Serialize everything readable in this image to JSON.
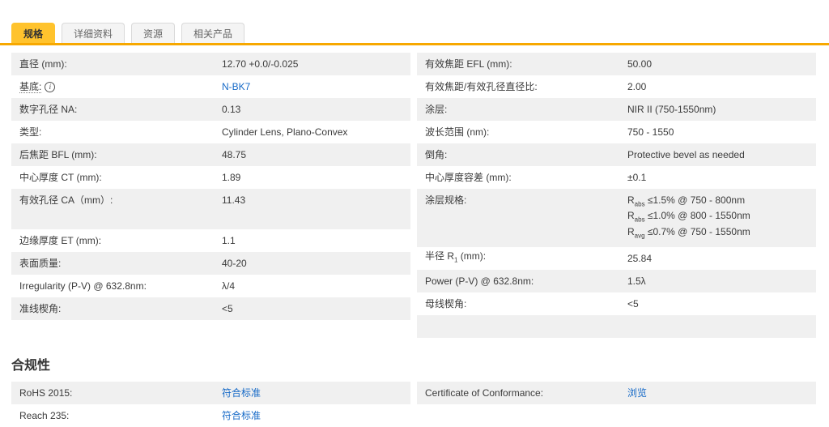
{
  "colors": {
    "accent_yellow": "#ffc32d",
    "tab_underline_orange": "#f7a800",
    "link_blue": "#1569c7",
    "row_gray": "#f0f0f0",
    "text": "#3b3b3b"
  },
  "tabs": [
    {
      "label": "规格",
      "active": true
    },
    {
      "label": "详细资料",
      "active": false
    },
    {
      "label": "资源",
      "active": false
    },
    {
      "label": "相关产品",
      "active": false
    }
  ],
  "icons": {
    "info_glyph": "i"
  },
  "spec_left": {
    "rows": [
      {
        "label": "直径 (mm):",
        "value": "12.70 +0.0/-0.025"
      },
      {
        "label": "基底:",
        "value": "N-BK7"
      },
      {
        "label": "数字孔径 NA:",
        "value": "0.13"
      },
      {
        "label": "类型:",
        "value": "Cylinder Lens, Plano-Convex"
      },
      {
        "label": "后焦距 BFL (mm):",
        "value": "48.75"
      },
      {
        "label": "中心厚度 CT (mm):",
        "value": "1.89"
      },
      {
        "label": "有效孔径 CA（mm）:",
        "value": "11.43"
      },
      {
        "label": "边缘厚度 ET (mm):",
        "value": "1.1"
      },
      {
        "label": "表面质量:",
        "value": "40-20"
      },
      {
        "label": "Irregularity (P-V) @ 632.8nm:",
        "value": "λ/4"
      },
      {
        "label": "准线楔角:",
        "value": "<5"
      }
    ]
  },
  "spec_right": {
    "rows": [
      {
        "label": "有效焦距 EFL (mm):",
        "value": "50.00"
      },
      {
        "label": "有效焦距/有效孔径直径比:",
        "value": "2.00"
      },
      {
        "label": "涂层:",
        "value": "NIR II (750-1550nm)"
      },
      {
        "label": "波长范围 (nm):",
        "value": "750 - 1550"
      },
      {
        "label": "倒角:",
        "value": "Protective bevel as needed"
      },
      {
        "label": "中心厚度容差 (mm):",
        "value": "±0.1"
      },
      {
        "label": "涂层规格:",
        "value_lines": [
          {
            "base": "R",
            "sub": "abs",
            "rest": " ≤1.5% @ 750 - 800nm"
          },
          {
            "base": "R",
            "sub": "abs",
            "rest": " ≤1.0% @ 800 - 1550nm"
          },
          {
            "base": "R",
            "sub": "avg",
            "rest": " ≤0.7% @ 750 - 1550nm"
          }
        ]
      },
      {
        "label_base": "半径 R",
        "label_sub": "1",
        "label_rest": " (mm):",
        "value": "25.84"
      },
      {
        "label": "Power (P-V) @ 632.8nm:",
        "value": "1.5λ"
      },
      {
        "label": "母线楔角:",
        "value": "<5"
      }
    ]
  },
  "compliance": {
    "title": "合规性",
    "left_rows": [
      {
        "label": "RoHS 2015:",
        "link": "符合标准"
      },
      {
        "label": "Reach 235:",
        "link": "符合标准"
      }
    ],
    "right_rows": [
      {
        "label": "Certificate of Conformance:",
        "link": "浏览"
      }
    ]
  }
}
